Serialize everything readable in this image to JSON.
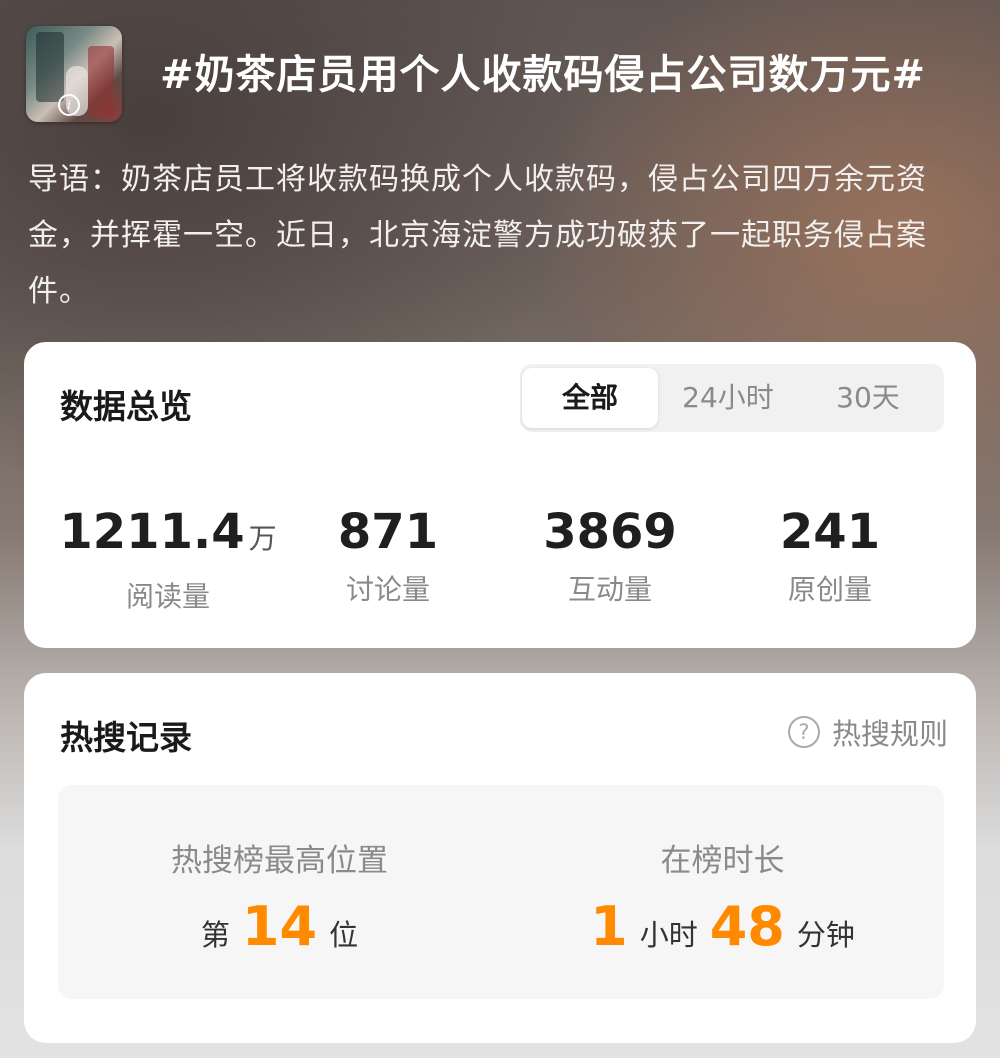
{
  "header": {
    "title": "#奶茶店员用个人收款码侵占公司数万元#",
    "lead": "导语：奶茶店员工将收款码换成个人收款码，侵占公司四万余元资金，并挥霍一空。近日，北京海淀警方成功破获了一起职务侵占案件。"
  },
  "overview": {
    "title": "数据总览",
    "tabs": [
      {
        "label": "全部",
        "active": true
      },
      {
        "label": "24小时",
        "active": false
      },
      {
        "label": "30天",
        "active": false
      }
    ],
    "stats": [
      {
        "value": "1211.4",
        "unit": "万",
        "label": "阅读量"
      },
      {
        "value": "871",
        "unit": "",
        "label": "讨论量"
      },
      {
        "value": "3869",
        "unit": "",
        "label": "互动量"
      },
      {
        "value": "241",
        "unit": "",
        "label": "原创量"
      }
    ]
  },
  "hot_search": {
    "title": "热搜记录",
    "rule_label": "热搜规则",
    "rule_icon": "question-circle-icon",
    "peak": {
      "label": "热搜榜最高位置",
      "prefix": "第",
      "value": "14",
      "suffix": "位"
    },
    "duration": {
      "label": "在榜时长",
      "hours": "1",
      "hours_unit": "小时",
      "minutes": "48",
      "minutes_unit": "分钟"
    },
    "accent_color": "#ff8a00"
  }
}
